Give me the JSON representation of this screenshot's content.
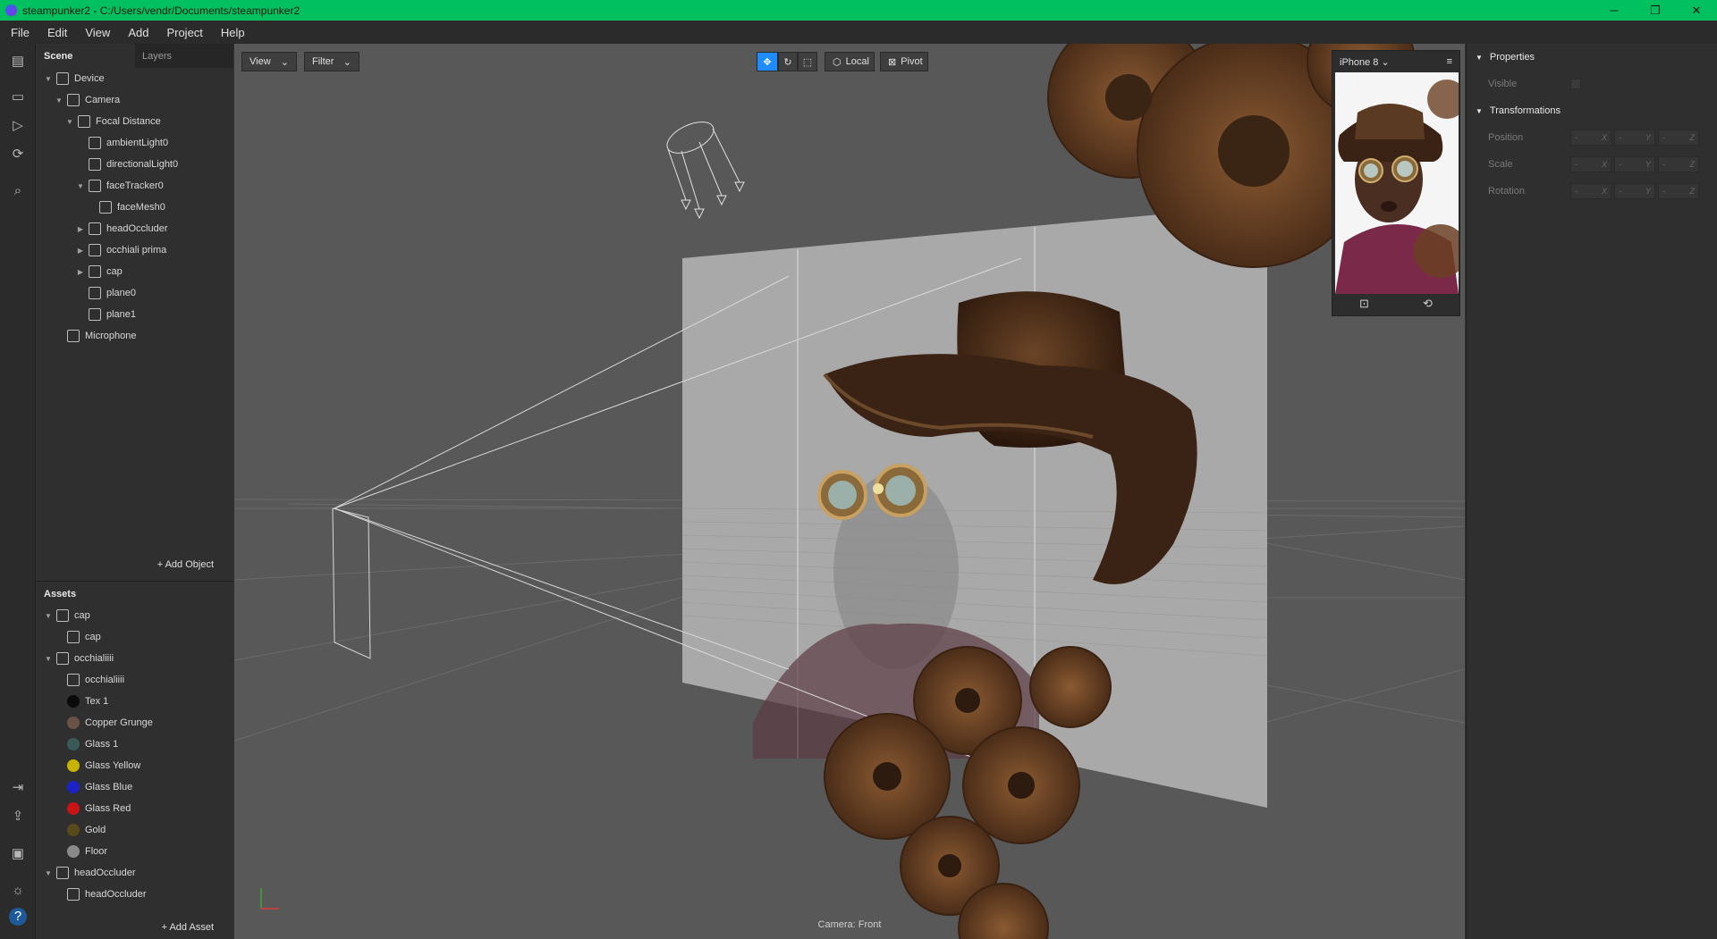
{
  "window": {
    "title": "steampunker2 - C:/Users/vendr/Documents/steampunker2",
    "min": "─",
    "restore": "❐",
    "close": "✕"
  },
  "menu": [
    "File",
    "Edit",
    "View",
    "Add",
    "Project",
    "Help"
  ],
  "scene": {
    "tabs": [
      "Scene",
      "Layers"
    ],
    "items": [
      {
        "label": "Device",
        "level": 0,
        "arrow": "▼",
        "icon": "device-icon"
      },
      {
        "label": "Camera",
        "level": 1,
        "arrow": "▼",
        "icon": "camera-icon"
      },
      {
        "label": "Focal Distance",
        "level": 2,
        "arrow": "▼",
        "icon": "focal-icon"
      },
      {
        "label": "ambientLight0",
        "level": 3,
        "arrow": "",
        "icon": "ambient-light-icon"
      },
      {
        "label": "directionalLight0",
        "level": 3,
        "arrow": "",
        "icon": "directional-light-icon"
      },
      {
        "label": "faceTracker0",
        "level": 3,
        "arrow": "▼",
        "icon": "face-tracker-icon"
      },
      {
        "label": "faceMesh0",
        "level": 4,
        "arrow": "",
        "icon": "face-mesh-icon"
      },
      {
        "label": "headOccluder",
        "level": 3,
        "arrow": "▶",
        "icon": "object-icon"
      },
      {
        "label": "occhiali prima",
        "level": 3,
        "arrow": "▶",
        "icon": "object-icon"
      },
      {
        "label": "cap",
        "level": 3,
        "arrow": "▶",
        "icon": "object-icon"
      },
      {
        "label": "plane0",
        "level": 3,
        "arrow": "",
        "icon": "plane-icon"
      },
      {
        "label": "plane1",
        "level": 3,
        "arrow": "",
        "icon": "plane-icon"
      },
      {
        "label": "Microphone",
        "level": 1,
        "arrow": "",
        "icon": "microphone-icon"
      }
    ],
    "add_object": "+ Add Object"
  },
  "assets": {
    "header": "Assets",
    "items": [
      {
        "label": "cap",
        "level": 0,
        "arrow": "▼",
        "kind": "file"
      },
      {
        "label": "cap",
        "level": 1,
        "arrow": "",
        "kind": "mesh"
      },
      {
        "label": "occhialiiii",
        "level": 0,
        "arrow": "▼",
        "kind": "file"
      },
      {
        "label": "occhialiiii",
        "level": 1,
        "arrow": "",
        "kind": "mesh"
      },
      {
        "label": "Tex 1",
        "level": 1,
        "arrow": "",
        "kind": "material",
        "color": "#0a0a0a"
      },
      {
        "label": "Copper Grunge",
        "level": 1,
        "arrow": "",
        "kind": "material",
        "color": "#6a5346"
      },
      {
        "label": "Glass 1",
        "level": 1,
        "arrow": "",
        "kind": "material",
        "color": "#3a5a58"
      },
      {
        "label": "Glass Yellow",
        "level": 1,
        "arrow": "",
        "kind": "material",
        "color": "#c8b400"
      },
      {
        "label": "Glass Blue",
        "level": 1,
        "arrow": "",
        "kind": "material",
        "color": "#1a22c8"
      },
      {
        "label": "Glass Red",
        "level": 1,
        "arrow": "",
        "kind": "material",
        "color": "#c81414"
      },
      {
        "label": "Gold",
        "level": 1,
        "arrow": "",
        "kind": "material",
        "color": "#5a4a1a"
      },
      {
        "label": "Floor",
        "level": 1,
        "arrow": "",
        "kind": "material",
        "color": "#8a8a8a"
      },
      {
        "label": "headOccluder",
        "level": 0,
        "arrow": "▼",
        "kind": "file"
      },
      {
        "label": "headOccluder",
        "level": 1,
        "arrow": "",
        "kind": "mesh"
      }
    ],
    "add_asset": "+ Add Asset"
  },
  "viewport": {
    "view_label": "View",
    "filter_label": "Filter",
    "local_label": "Local",
    "pivot_label": "Pivot",
    "camera_label": "Camera: Front",
    "device": "iPhone 8"
  },
  "properties": {
    "section1": "Properties",
    "visible": "Visible",
    "section2": "Transformations",
    "position": "Position",
    "scale": "Scale",
    "rotation": "Rotation",
    "axes": [
      "X",
      "Y",
      "Z"
    ],
    "dash": "-"
  },
  "colors": {
    "titlebar": "#00c060",
    "accent": "#1e8cff"
  }
}
